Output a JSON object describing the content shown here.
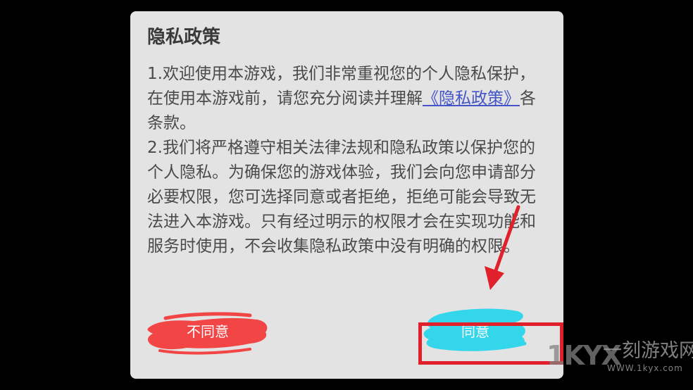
{
  "dialog": {
    "title": "隐私政策",
    "paragraph1": {
      "before_link": "1.欢迎使用本游戏，我们非常重视您的个人隐私保护，在使用本游戏前，请您充分阅读并理解",
      "link": "《隐私政策》",
      "after_link": "各条款。"
    },
    "paragraph2": "2.我们将严格遵守相关法律法规和隐私政策以保护您的个人隐私。为确保您的游戏体验，我们会向您申请部分必要权限，您可选择同意或者拒绝，拒绝可能会导致无法进入本游戏。只有经过明示的权限才会在实现功能和服务时使用，不会收集隐私政策中没有明确的权限。",
    "disagree_label": "不同意",
    "agree_label": "同意"
  },
  "colors": {
    "dialog_bg": "#e3e3e3",
    "disagree_brush": "#f24545",
    "agree_brush": "#33d6ea",
    "annotation_red": "#e0202a",
    "link": "#4455c8"
  },
  "annotation": {
    "box_target": "agree-button",
    "arrow_icon": "arrow-down-icon"
  },
  "watermark": {
    "logo_text": "1KYX",
    "name": "一刻游戏网",
    "url": "WWW.1kyx.com"
  }
}
